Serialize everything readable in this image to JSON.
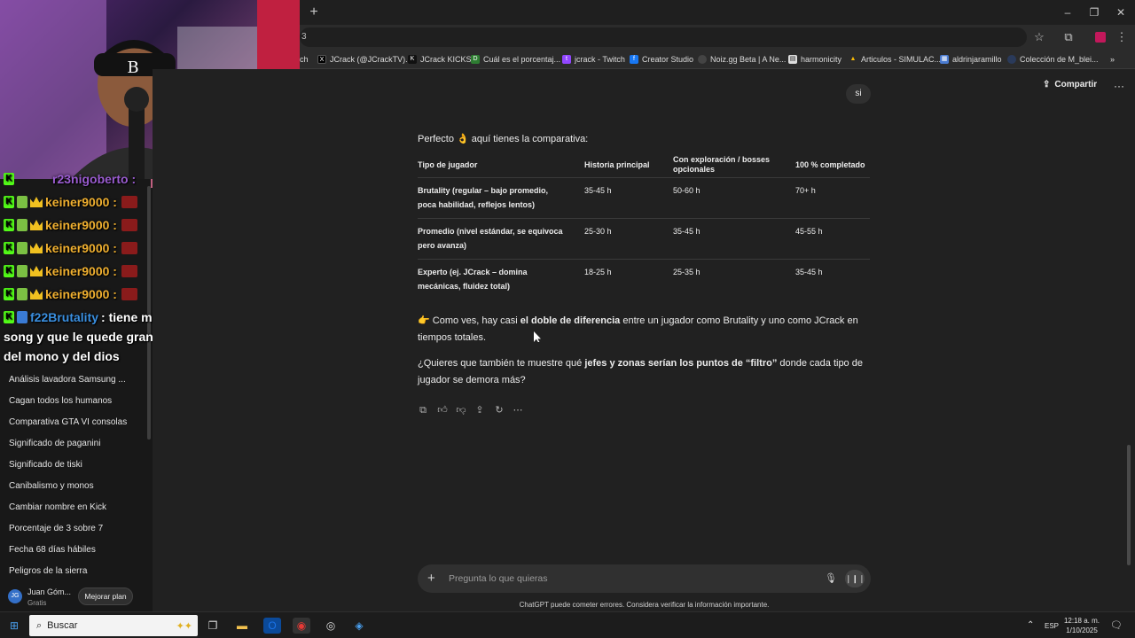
{
  "browser": {
    "new_tab": "+",
    "address_fragment": "3",
    "window_controls": {
      "minimize": "–",
      "restore": "❐",
      "close": "✕"
    },
    "bookmarks": [
      {
        "label": "ch"
      },
      {
        "label": "JCrack (@JCrackTV)..."
      },
      {
        "label": "JCrack KICKS"
      },
      {
        "label": "Cuál es el porcentaj..."
      },
      {
        "label": "jcrack - Twitch"
      },
      {
        "label": "Creator Studio"
      },
      {
        "label": "Noiz.gg Beta | A Ne..."
      },
      {
        "label": "harmonicity"
      },
      {
        "label": "Articulos - SIMULAC..."
      },
      {
        "label": "aldrinjaramillo"
      },
      {
        "label": "Colección de M_blei..."
      }
    ],
    "overflow": "»"
  },
  "sidebar": {
    "chats": [
      "Análisis lavadora Samsung ...",
      "Cagan todos los humanos",
      "Comparativa GTA VI consolas",
      "Significado de paganini",
      "Significado de tiski",
      "Canibalismo y monos",
      "Cambiar nombre en Kick",
      "Porcentaje de 3 sobre 7",
      "Fecha 68 días hábiles",
      "Peligros de la sierra"
    ],
    "user": {
      "initials": "JG",
      "name": "Juan Góm...",
      "plan": "Gratis"
    },
    "upgrade_label": "Mejorar plan"
  },
  "stream_chat": {
    "partial_user": "r23nigoberto :",
    "lines": [
      {
        "user": "keiner9000 :"
      },
      {
        "user": "keiner9000 :"
      },
      {
        "user": "keiner9000 :"
      },
      {
        "user": "keiner9000 :"
      },
      {
        "user": "keiner9000 :"
      }
    ],
    "message": {
      "user": "f22Brutality",
      "text1": ": tiene miedo de jugar silk",
      "text2": "song y que le quede grande como el juego",
      "text3": "del mono y del dios"
    }
  },
  "header": {
    "share_label": "Compartir",
    "more": "···"
  },
  "conversation": {
    "user_message": "si",
    "intro": "Perfecto 👌 aquí tienes la comparativa:",
    "table": {
      "headers": [
        "Tipo de jugador",
        "Historia principal",
        "Con exploración / bosses opcionales",
        "100 % completado"
      ],
      "rows": [
        [
          "Brutality (regular – bajo promedio, poca habilidad, reflejos lentos)",
          "35-45 h",
          "50-60 h",
          "70+ h"
        ],
        [
          "Promedio (nivel estándar, se equivoca pero avanza)",
          "25-30 h",
          "35-45 h",
          "45-55 h"
        ],
        [
          "Experto (ej. JCrack – domina mecánicas, fluidez total)",
          "18-25 h",
          "25-35 h",
          "35-45 h"
        ]
      ]
    },
    "para1": {
      "pre": "👉 Como ves, hay casi ",
      "bold": "el doble de diferencia",
      "post": " entre un jugador como Brutality y uno como JCrack en tiempos totales."
    },
    "para2": {
      "pre": "¿Quieres que también te muestre qué ",
      "bold": "jefes y zonas serían los puntos de “filtro”",
      "post": " donde cada tipo de jugador se demora más?"
    }
  },
  "composer": {
    "placeholder": "Pregunta lo que quieras",
    "disclaimer": "ChatGPT puede cometer errores. Considera verificar la información importante."
  },
  "taskbar": {
    "search_label": "Buscar",
    "language": "ESP",
    "time": "12:18 a. m.",
    "date": "1/10/2025"
  }
}
